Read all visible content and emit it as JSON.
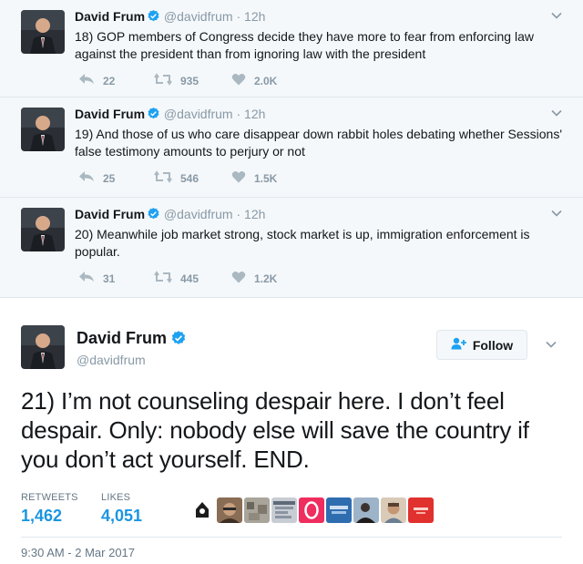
{
  "author": {
    "name": "David Frum",
    "handle": "@davidfrum"
  },
  "thread": [
    {
      "time": "12h",
      "text": "18) GOP members of Congress decide they have more to fear from enforcing law against the president than from ignoring law with the president",
      "replies": "22",
      "retweets": "935",
      "likes": "2.0K"
    },
    {
      "time": "12h",
      "text": "19) And those of us who care disappear down rabbit holes debating whether Sessions' false testimony amounts to perjury or not",
      "replies": "25",
      "retweets": "546",
      "likes": "1.5K"
    },
    {
      "time": "12h",
      "text": "20) Meanwhile job market strong, stock market is up, immigration enforcement is popular.",
      "replies": "31",
      "retweets": "445",
      "likes": "1.2K"
    }
  ],
  "main_tweet": {
    "follow_label": "Follow",
    "text": "21) I’m not counseling despair here. I don’t feel despair. Only: nobody else will save the country if you don’t act yourself. END.",
    "retweets_label": "RETWEETS",
    "retweets": "1,462",
    "likes_label": "LIKES",
    "likes": "4,051",
    "timestamp": "9:30 AM - 2 Mar 2017"
  },
  "colors": {
    "link_blue": "#1b95e0",
    "muted": "#8899a6",
    "verified": "#1da1f2"
  },
  "icons": [
    "verified-badge-icon",
    "chevron-down-icon",
    "reply-icon",
    "retweet-icon",
    "heart-icon",
    "follow-user-icon"
  ]
}
